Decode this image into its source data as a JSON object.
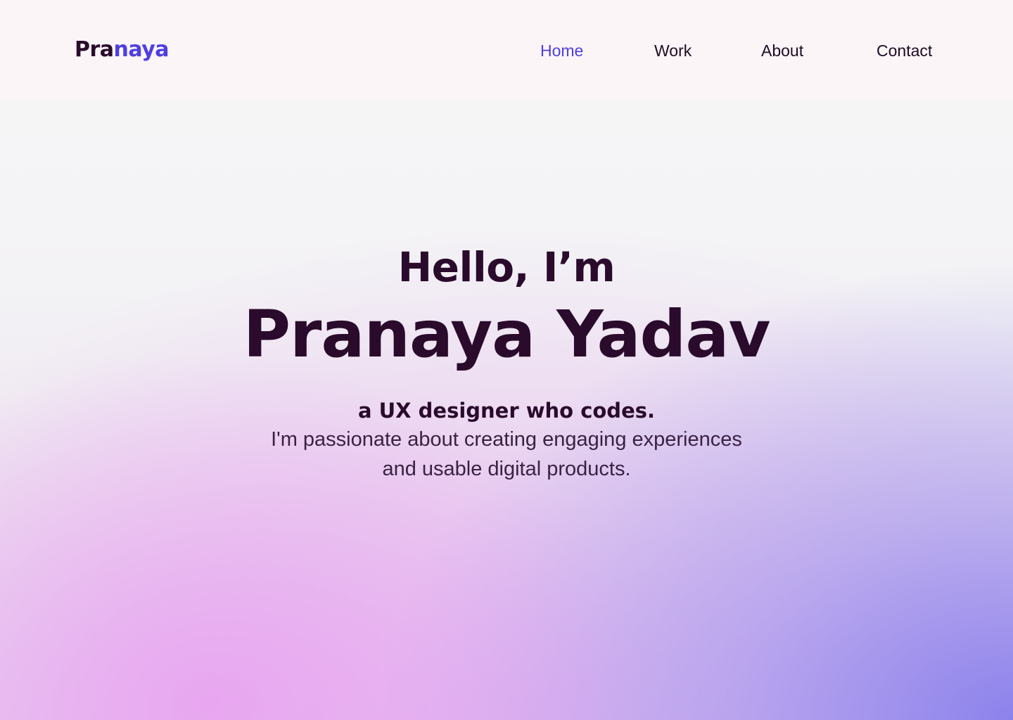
{
  "header": {
    "logo_part1": "Pra",
    "logo_part2": "naya",
    "nav": [
      {
        "label": "Home",
        "active": true
      },
      {
        "label": "Work",
        "active": false
      },
      {
        "label": "About",
        "active": false
      },
      {
        "label": "Contact",
        "active": false
      }
    ]
  },
  "hero": {
    "greeting": "Hello, I’m",
    "name": "Pranaya Yadav",
    "tagline": "a UX designer who codes.",
    "bio_line1": "I'm passionate about creating engaging experiences",
    "bio_line2": "and usable digital products."
  },
  "colors": {
    "accent": "#4f3ee0",
    "text_dark": "#2a0b2c",
    "header_bg": "#fbf5f8"
  }
}
